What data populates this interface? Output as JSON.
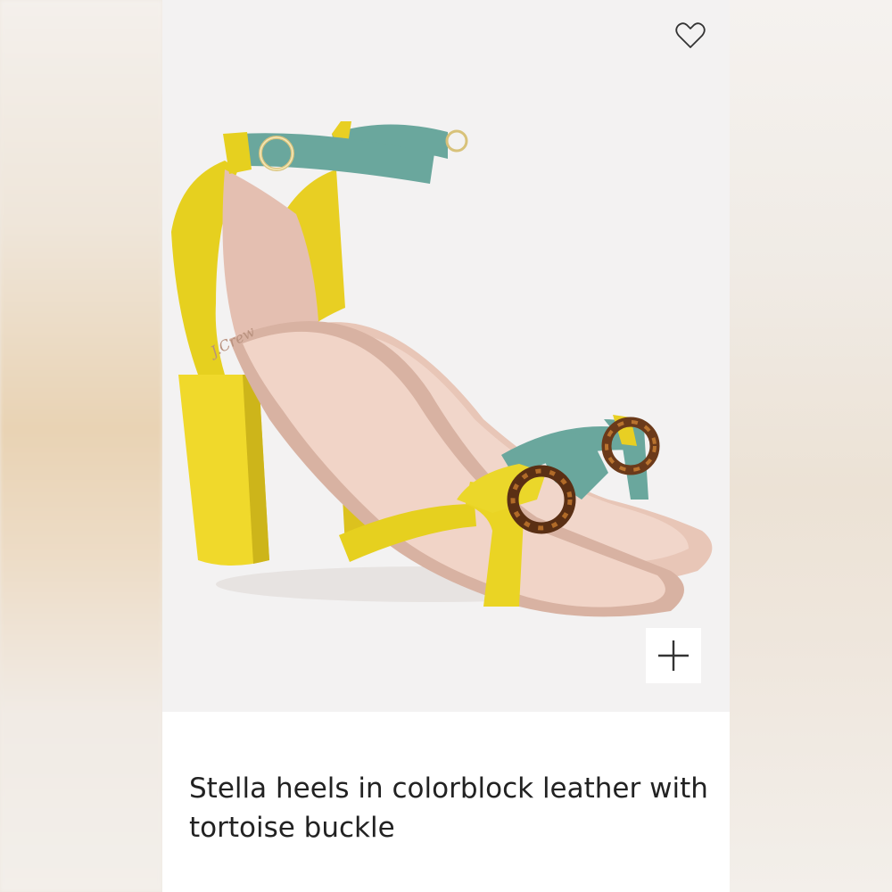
{
  "product": {
    "title": "Stella heels in colorblock leather with tortoise buckle",
    "image_alt": "Yellow and teal colorblock leather block-heel sandals with ankle strap and tortoise ring buckle",
    "insole_logo": "J.Crew"
  },
  "actions": {
    "favorite_icon": "heart-outline-icon",
    "zoom_icon": "plus-icon"
  },
  "colors": {
    "yellow": "#ecd52a",
    "teal": "#6aa79d",
    "blush": "#efcbbd",
    "tortoise": "#6b3a1a",
    "background": "#ffffff"
  }
}
